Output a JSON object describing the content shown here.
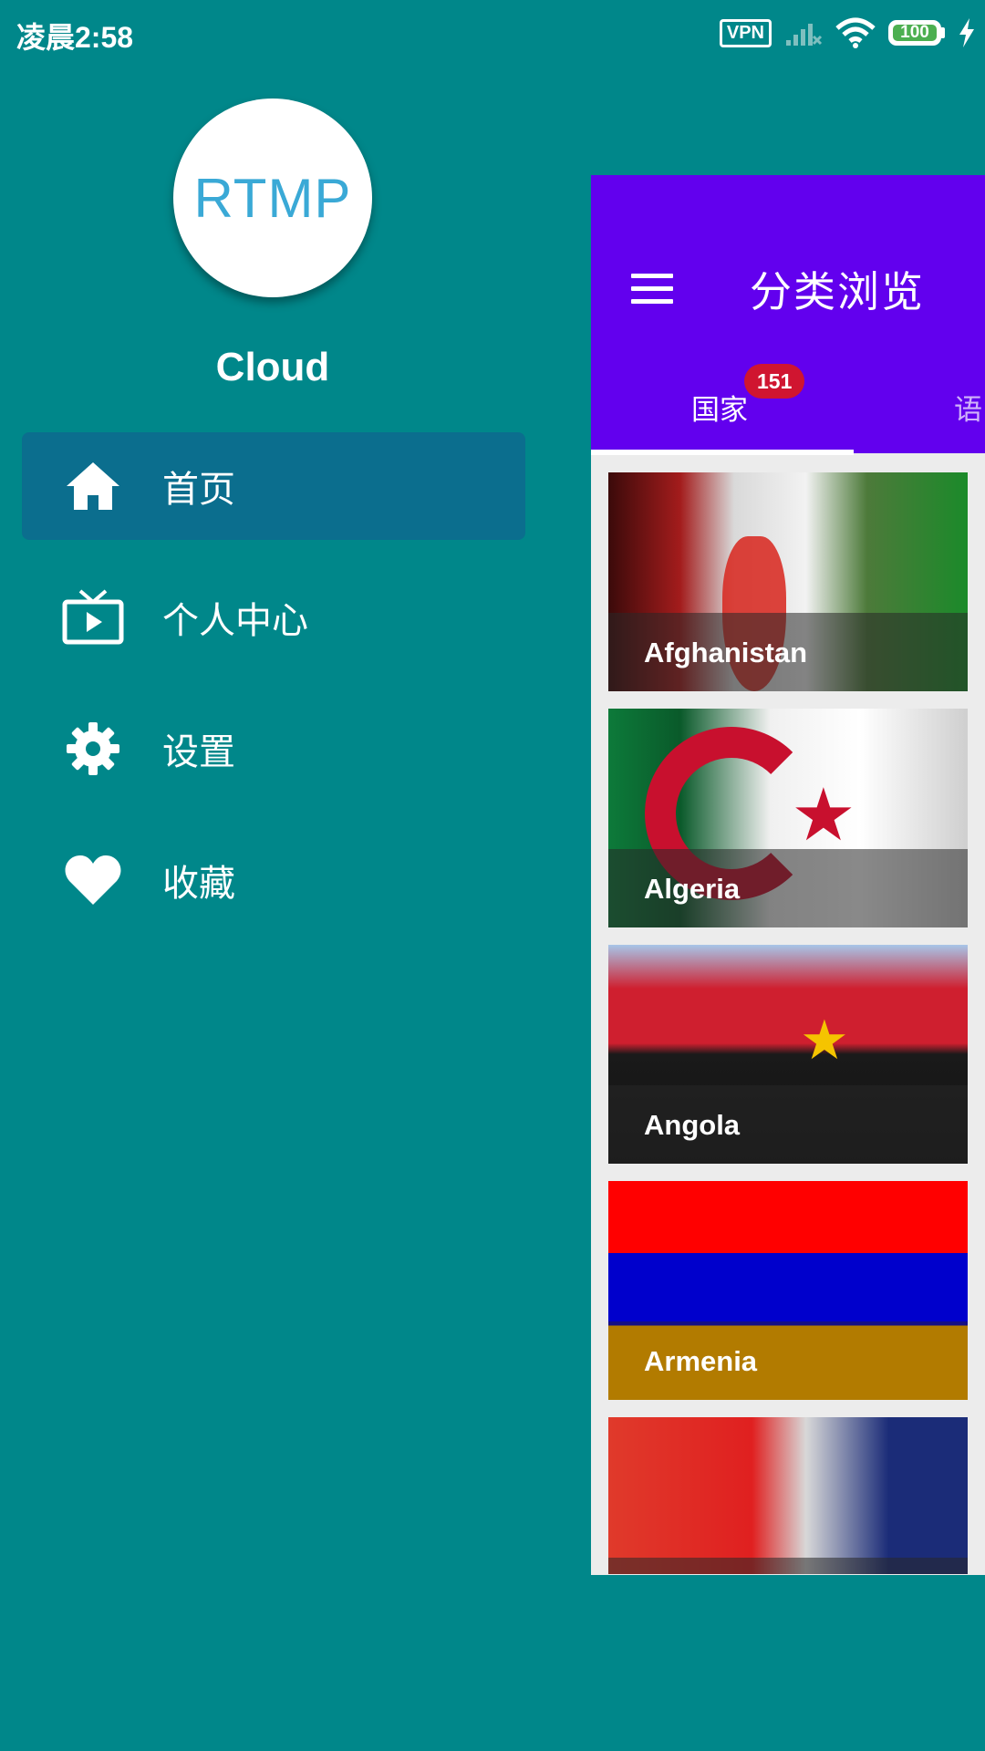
{
  "status_bar": {
    "time": "凌晨2:58",
    "vpn_label": "VPN",
    "battery_level": "100",
    "icons": [
      "vpn-icon",
      "signal-icon",
      "wifi-icon",
      "battery-icon",
      "charging-icon"
    ]
  },
  "drawer": {
    "avatar_text": "RTMP",
    "user_name": "Cloud",
    "items": [
      {
        "label": "首页",
        "icon": "home-icon",
        "active": true
      },
      {
        "label": "个人中心",
        "icon": "tv-icon",
        "active": false
      },
      {
        "label": "设置",
        "icon": "gear-icon",
        "active": false
      },
      {
        "label": "收藏",
        "icon": "heart-icon",
        "active": false
      }
    ]
  },
  "panel": {
    "title": "分类浏览",
    "tabs": [
      {
        "label": "国家",
        "badge": "151",
        "selected": true
      },
      {
        "label": "语",
        "selected": false
      }
    ],
    "cards": [
      {
        "label": "Afghanistan"
      },
      {
        "label": "Algeria"
      },
      {
        "label": "Angola"
      },
      {
        "label": "Armenia"
      },
      {
        "label": ""
      }
    ]
  },
  "colors": {
    "background": "#00878a",
    "appbar": "#6200ee",
    "active_item": "#0b6e8e",
    "badge": "#d01530"
  }
}
